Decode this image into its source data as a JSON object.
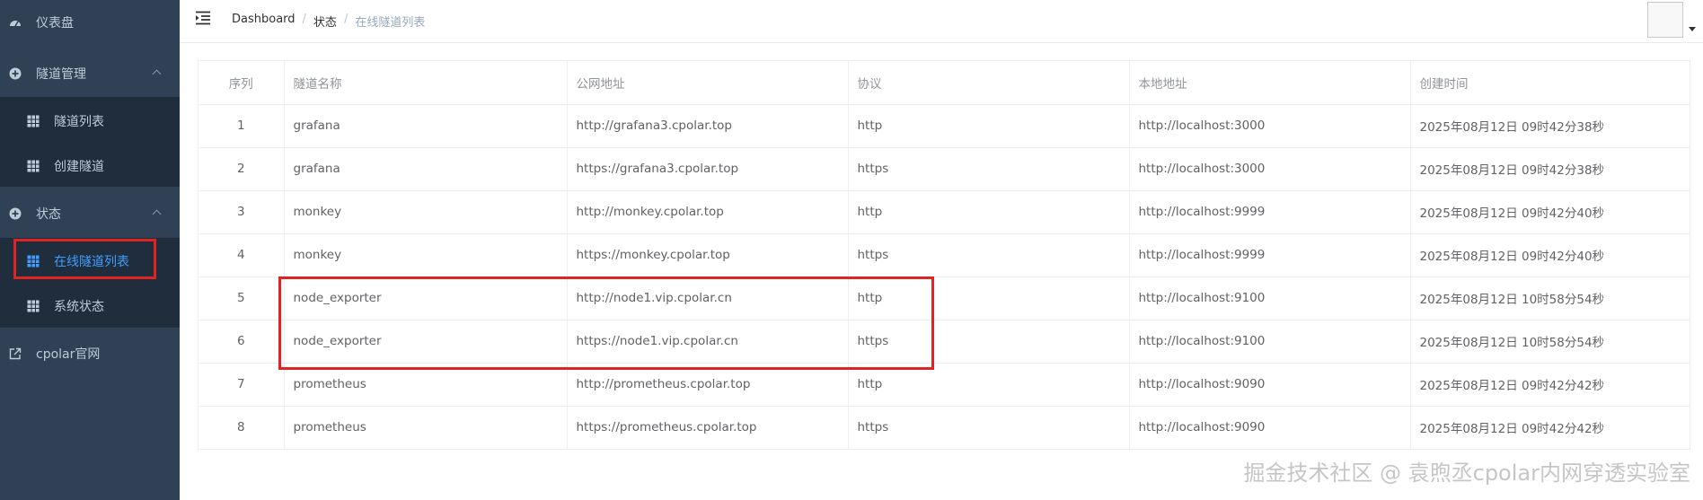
{
  "sidebar": {
    "dashboard": "仪表盘",
    "tunnel_mgmt": "隧道管理",
    "tunnel_list": "隧道列表",
    "create_tunnel": "创建隧道",
    "status": "状态",
    "online_tunnels": "在线隧道列表",
    "system_status": "系统状态",
    "official_site": "cpolar官网"
  },
  "breadcrumb": [
    "Dashboard",
    "状态",
    "在线隧道列表"
  ],
  "table": {
    "headers": [
      "序列",
      "隧道名称",
      "公网地址",
      "协议",
      "本地地址",
      "创建时间"
    ],
    "rows": [
      [
        "1",
        "grafana",
        "http://grafana3.cpolar.top",
        "http",
        "http://localhost:3000",
        "2025年08月12日 09时42分38秒"
      ],
      [
        "2",
        "grafana",
        "https://grafana3.cpolar.top",
        "https",
        "http://localhost:3000",
        "2025年08月12日 09时42分38秒"
      ],
      [
        "3",
        "monkey",
        "http://monkey.cpolar.top",
        "http",
        "http://localhost:9999",
        "2025年08月12日 09时42分40秒"
      ],
      [
        "4",
        "monkey",
        "https://monkey.cpolar.top",
        "https",
        "http://localhost:9999",
        "2025年08月12日 09时42分40秒"
      ],
      [
        "5",
        "node_exporter",
        "http://node1.vip.cpolar.cn",
        "http",
        "http://localhost:9100",
        "2025年08月12日 10时58分54秒"
      ],
      [
        "6",
        "node_exporter",
        "https://node1.vip.cpolar.cn",
        "https",
        "http://localhost:9100",
        "2025年08月12日 10时58分54秒"
      ],
      [
        "7",
        "prometheus",
        "http://prometheus.cpolar.top",
        "http",
        "http://localhost:9090",
        "2025年08月12日 09时42分42秒"
      ],
      [
        "8",
        "prometheus",
        "https://prometheus.cpolar.top",
        "https",
        "http://localhost:9090",
        "2025年08月12日 09时42分42秒"
      ]
    ]
  },
  "watermark": "掘金技术社区 @ 袁煦丞cpolar内网穿透实验室",
  "colors": {
    "sidebar_bg": "#304156",
    "submenu_bg": "#1f2d3d",
    "active": "#409eff",
    "highlight": "#e02424"
  }
}
